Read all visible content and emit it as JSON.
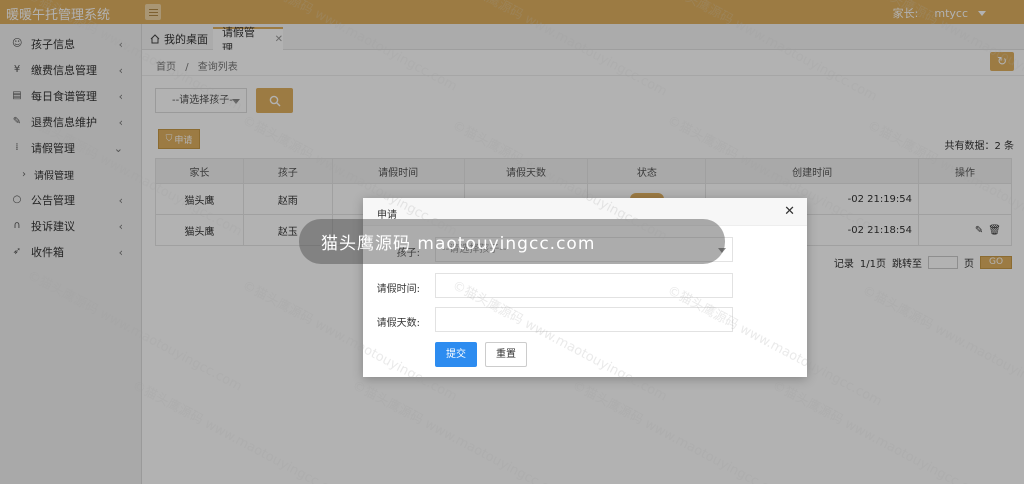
{
  "app": {
    "title": "暖暖午托管理系统"
  },
  "header": {
    "role_label": "家长:",
    "user_name": "mtycc"
  },
  "sidebar": {
    "items": [
      {
        "label": "孩子信息",
        "icon": "user-icon"
      },
      {
        "label": "缴费信息管理",
        "icon": "money-icon"
      },
      {
        "label": "每日食谱管理",
        "icon": "notebook-icon"
      },
      {
        "label": "退费信息维护",
        "icon": "edit-icon"
      },
      {
        "label": "请假管理",
        "icon": "grid-icon"
      },
      {
        "label": "请假管理",
        "icon": "arrow-icon"
      },
      {
        "label": "公告管理",
        "icon": "clock-icon"
      },
      {
        "label": "投诉建议",
        "icon": "headset-icon"
      },
      {
        "label": "收件箱",
        "icon": "send-icon"
      }
    ]
  },
  "tabs": {
    "home": "我的桌面",
    "active": "请假管理"
  },
  "breadcrumb": {
    "home": "首页",
    "current": "查询列表"
  },
  "filters": {
    "child_select": "--请选择孩子--"
  },
  "toolbar": {
    "apply_label": "申请",
    "total_text": "共有数据：2 条"
  },
  "table": {
    "headers": [
      "家长",
      "孩子",
      "请假时间",
      "请假天数",
      "状态",
      "创建时间",
      "操作"
    ],
    "rows": [
      {
        "parent": "猫头鹰",
        "child": "赵雨",
        "created_suffix": "-02 21:19:54"
      },
      {
        "parent": "猫头鹰",
        "child": "赵玉",
        "created_suffix": "-02 21:18:54"
      }
    ]
  },
  "pager": {
    "records_suffix": "记录",
    "page_info": "1/1页",
    "jump_label": "跳转至",
    "page_unit": "页",
    "go_label": "GO"
  },
  "modal": {
    "title": "申请",
    "child_label": "孩子:",
    "child_placeholder": "--请选择孩子--",
    "time_label": "请假时间:",
    "days_label": "请假天数:",
    "submit_label": "提交",
    "reset_label": "重置"
  },
  "toast": {
    "text": "猫头鹰源码 maotouyingcc.com"
  },
  "watermark": {
    "text": "©猫头鹰源码 www.maotouyingcc.com"
  },
  "colors": {
    "accent": "#e0b060",
    "primary_button": "#2d8cf0"
  }
}
